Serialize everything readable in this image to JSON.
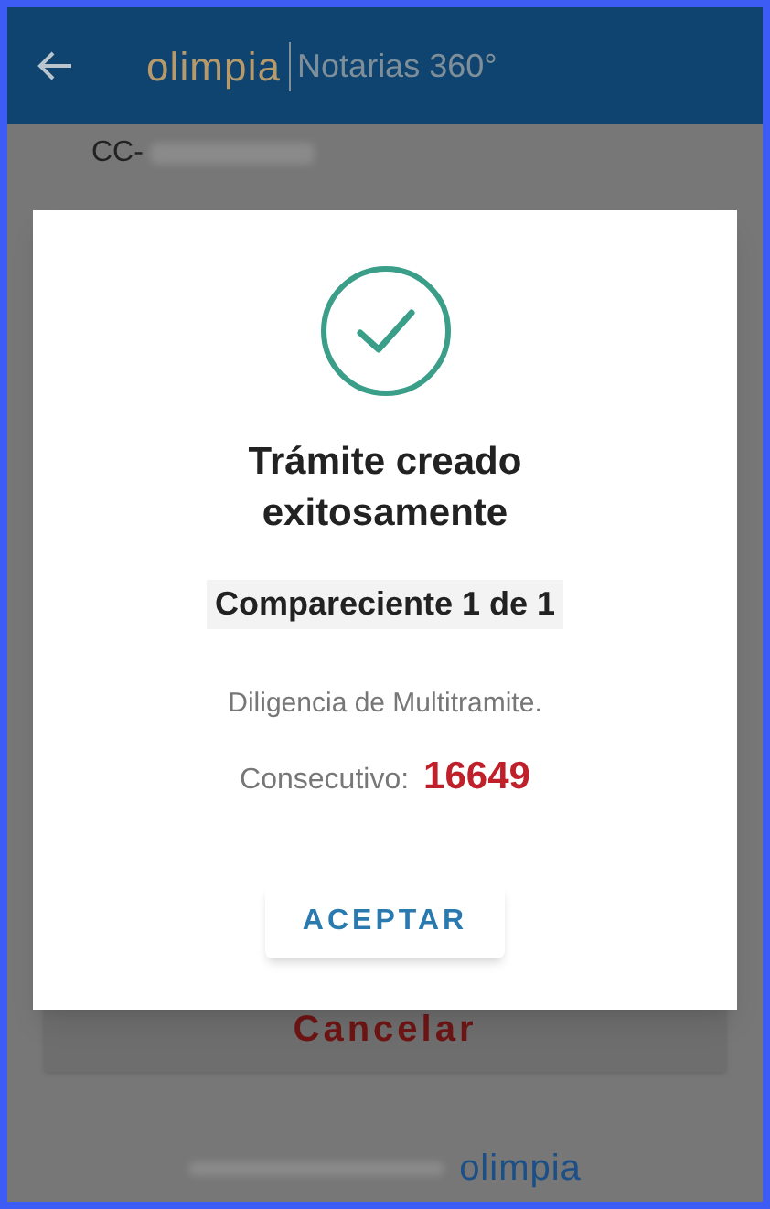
{
  "header": {
    "logo": "olimpia",
    "subtitle": "Notarias 360°"
  },
  "background": {
    "document_label": "CC-",
    "cancel_button": "Cancelar",
    "footer_logo": "olimpia"
  },
  "dialog": {
    "title": "Trámite creado exitosamente",
    "subtitle": "Compareciente 1 de 1",
    "description": "Diligencia de Multitramite.",
    "consecutive_label": "Consecutivo:",
    "consecutive_value": "16649",
    "button": "ACEPTAR"
  }
}
